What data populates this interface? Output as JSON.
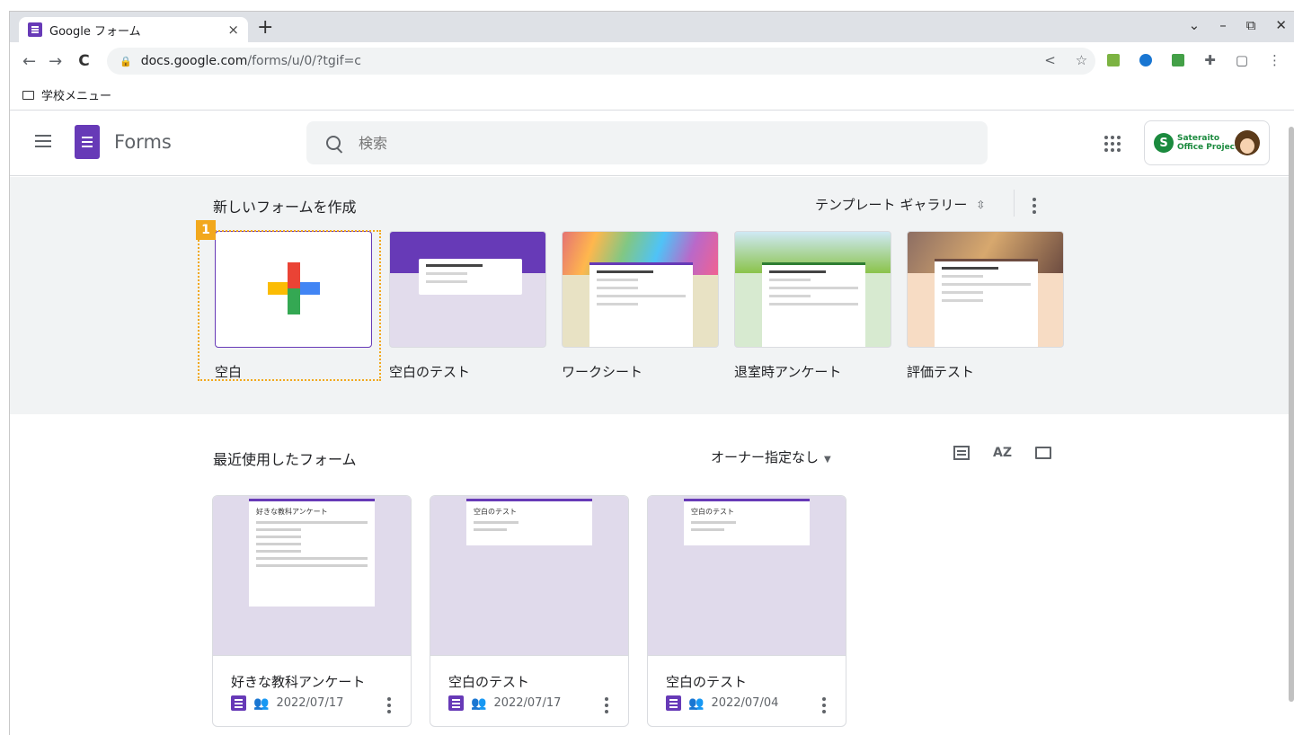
{
  "browser": {
    "tab_title": "Google フォーム",
    "tab_close": "×",
    "new_tab": "+",
    "window_controls": [
      "⌄",
      "–",
      "⧉",
      "✕"
    ],
    "url_host": "docs.google.com",
    "url_path": "/forms/u/0/?tgif=c",
    "bookmark": "学校メニュー"
  },
  "app": {
    "name": "Forms",
    "search_placeholder": "検索",
    "account_logo_text": "Sateraito",
    "account_logo_sub": "Office Project"
  },
  "create": {
    "title": "新しいフォームを作成",
    "gallery_label": "テンプレート ギャラリー",
    "badge": "1",
    "templates": [
      {
        "label": "空白"
      },
      {
        "label": "空白のテスト"
      },
      {
        "label": "ワークシート"
      },
      {
        "label": "退室時アンケート"
      },
      {
        "label": "評価テスト"
      }
    ]
  },
  "recent": {
    "title": "最近使用したフォーム",
    "owner_filter": "オーナー指定なし",
    "az_label": "AZ",
    "cards": [
      {
        "title": "好きな教科アンケート",
        "date": "2022/07/17",
        "thumb_title": "好きな教科アンケート"
      },
      {
        "title": "空白のテスト",
        "date": "2022/07/17",
        "thumb_title": "空白のテスト"
      },
      {
        "title": "空白のテスト",
        "date": "2022/07/04",
        "thumb_title": "空白のテスト"
      }
    ]
  },
  "colors": {
    "forms_purple": "#673ab7",
    "highlight_orange": "#f2a81d"
  }
}
